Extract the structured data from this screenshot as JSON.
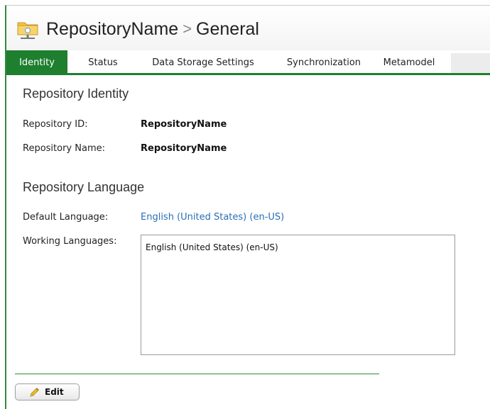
{
  "header": {
    "repository_name": "RepositoryName",
    "separator": ">",
    "page_name": "General",
    "icon": "repository-folder-icon"
  },
  "tabs": [
    {
      "label": "Identity",
      "active": true
    },
    {
      "label": "Status",
      "active": false
    },
    {
      "label": "Data Storage Settings",
      "active": false
    },
    {
      "label": "Synchronization",
      "active": false
    },
    {
      "label": "Metamodel",
      "active": false
    }
  ],
  "identity": {
    "heading": "Repository Identity",
    "id_label": "Repository ID:",
    "id_value": "RepositoryName",
    "name_label": "Repository Name:",
    "name_value": "RepositoryName"
  },
  "language": {
    "heading": "Repository Language",
    "default_label": "Default Language:",
    "default_value": "English (United States) (en-US)",
    "working_label": "Working Languages:",
    "working_items": [
      "English (United States) (en-US)"
    ]
  },
  "actions": {
    "edit_label": "Edit",
    "edit_icon": "pencil-icon"
  },
  "colors": {
    "accent": "#1e7f2e",
    "link": "#2a6eb5"
  }
}
